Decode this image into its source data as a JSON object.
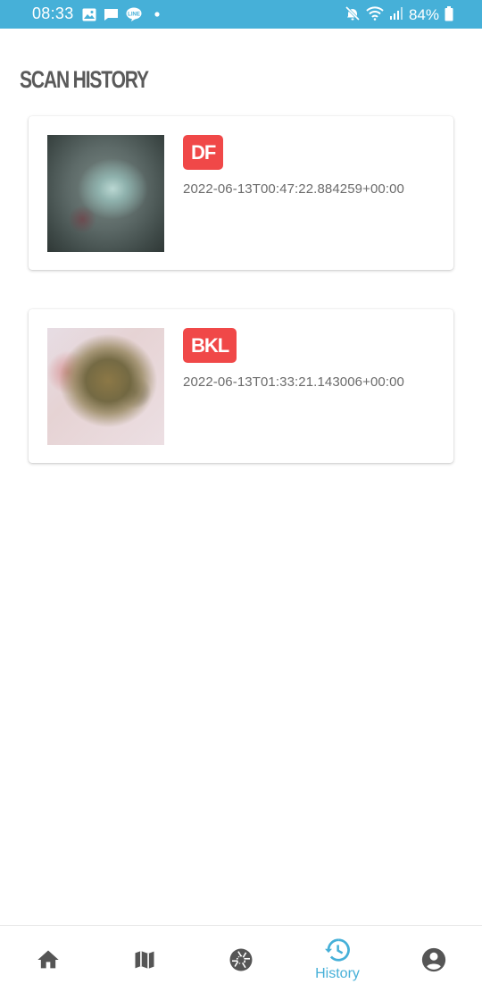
{
  "status_bar": {
    "time": "08:33",
    "battery": "84%",
    "background": "#46b0d8",
    "left_icons": [
      "image-icon",
      "message-icon",
      "line-icon",
      "dot-icon"
    ],
    "right_icons": [
      "mute-icon",
      "wifi-icon",
      "signal-icon",
      "battery-icon"
    ]
  },
  "page": {
    "title": "SCAN HISTORY"
  },
  "scans": [
    {
      "label": "DF",
      "timestamp": "2022-06-13T00:47:22.884259+00:00",
      "badge_color": "#f04848"
    },
    {
      "label": "BKL",
      "timestamp": "2022-06-13T01:33:21.143006+00:00",
      "badge_color": "#f04848"
    }
  ],
  "bottom_nav": {
    "accent": "#46b0d8",
    "inactive_color": "#555555",
    "items": [
      {
        "icon": "home-icon",
        "label": ""
      },
      {
        "icon": "map-icon",
        "label": ""
      },
      {
        "icon": "camera-aperture-icon",
        "label": ""
      },
      {
        "icon": "history-icon",
        "label": "History",
        "active": true
      },
      {
        "icon": "account-icon",
        "label": ""
      }
    ]
  }
}
